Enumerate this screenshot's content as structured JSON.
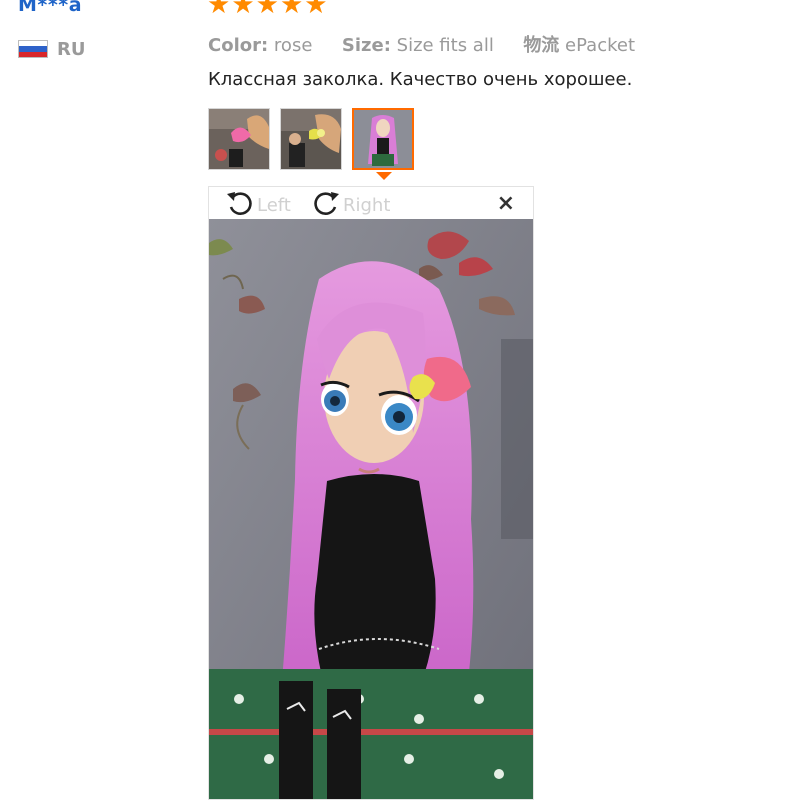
{
  "reviewer": {
    "name": "M***a",
    "country_code": "RU",
    "flag_colors": [
      "#ffffff",
      "#2e62c9",
      "#d9262a"
    ],
    "rating": 5,
    "rating_max": 5
  },
  "attributes": [
    {
      "key": "Color:",
      "value": "rose"
    },
    {
      "key": "Size:",
      "value": "Size fits all"
    },
    {
      "key": "物流",
      "value": "ePacket"
    }
  ],
  "review_text": "Классная заколка. Качество очень хорошее.",
  "thumbnails": {
    "count": 3,
    "selected_index": 2
  },
  "viewer": {
    "rotate_left_label": "Left",
    "rotate_right_label": "Right",
    "close_symbol": "×",
    "icons": [
      "rotate-left-icon",
      "rotate-right-icon",
      "close-icon"
    ]
  },
  "colors": {
    "accent": "#ff6a00",
    "star": "#ff8a00",
    "link": "#1f64c8",
    "muted": "#9a9a9a"
  }
}
